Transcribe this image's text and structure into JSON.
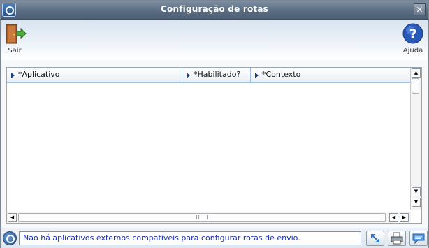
{
  "window": {
    "title": "Configuração de rotas",
    "close_glyph": "✕"
  },
  "toolbar": {
    "exit_label": "Sair",
    "exit_icon": "door-exit-icon",
    "help_label": "Ajuda",
    "help_icon": "help-question-icon"
  },
  "grid": {
    "columns": [
      "*Aplicativo",
      "*Habilitado?",
      "*Contexto"
    ],
    "rows": []
  },
  "status": {
    "message": "Não há aplicativos externos compatíveis para configurar rotas de envio."
  },
  "colors": {
    "titlebar": "#5b6d82",
    "header_border": "#9fc0de",
    "status_text": "#1a2fb0"
  }
}
